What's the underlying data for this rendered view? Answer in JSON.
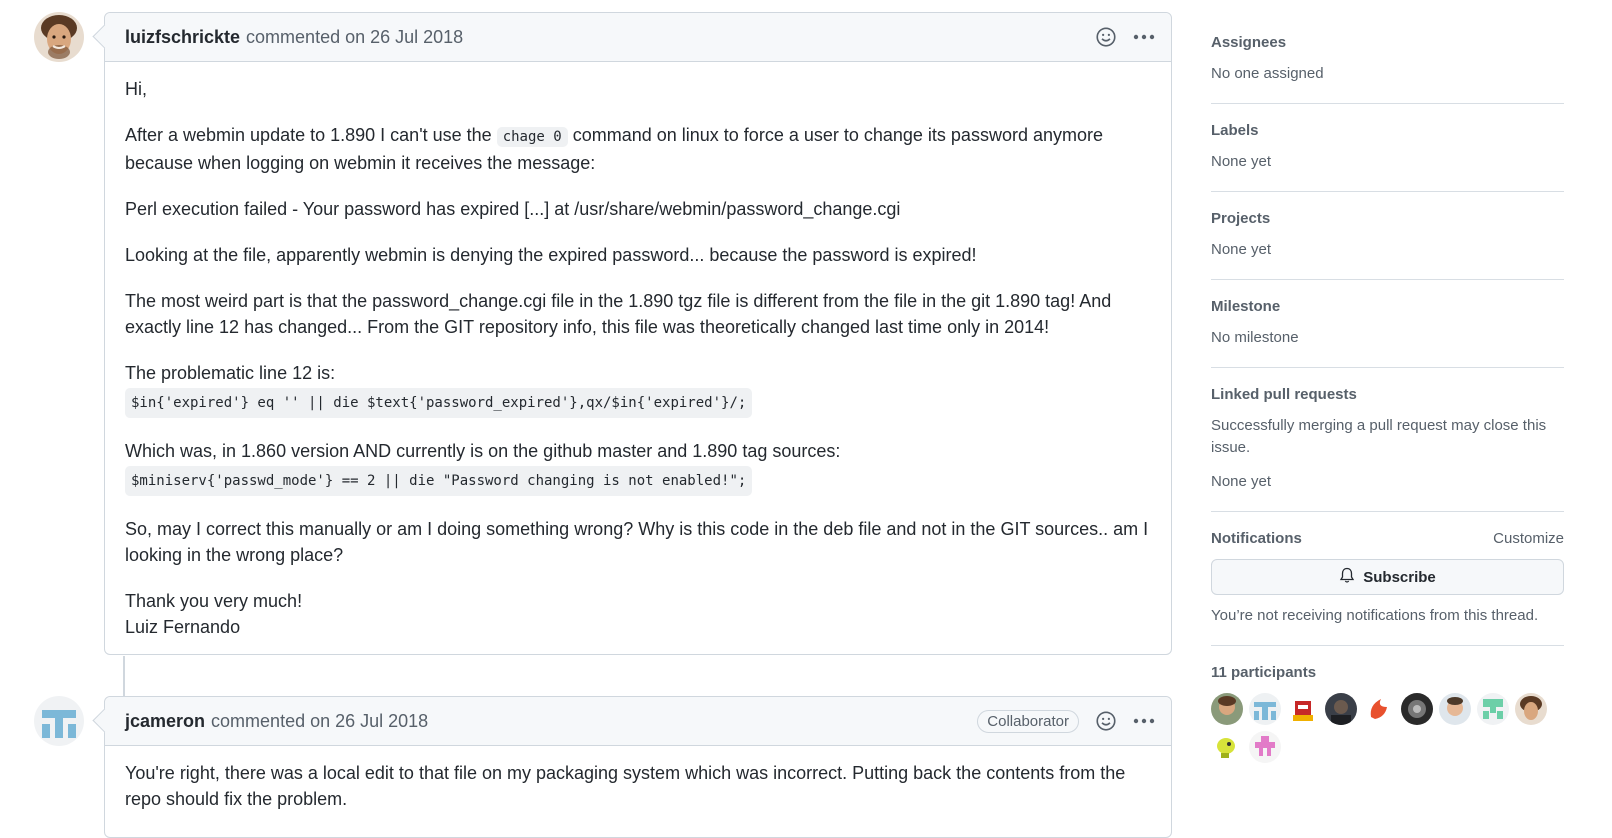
{
  "comments": [
    {
      "author": "luizfschrickte",
      "meta": "commented on 26 Jul 2018",
      "body": {
        "greeting": "Hi,",
        "p1_before": "After a webmin update to 1.890 I can't use the",
        "p1_code": "chage 0",
        "p1_after": "command on linux to force a user to change its password anymore because when logging on webmin it receives the message:",
        "p2": "Perl execution failed - Your password has expired [...] at /usr/share/webmin/password_change.cgi",
        "p3": "Looking at the file, apparently webmin is denying the expired password... because the password is expired!",
        "p4": "The most weird part is that the password_change.cgi file in the 1.890 tgz file is different from the file in the git 1.890 tag! And exactly line 12 has changed... From the GIT repository info, this file was theoretically changed last time only in 2014!",
        "p5_text": "The problematic line 12 is:",
        "p5_code": "$in{'expired'} eq '' || die $text{'password_expired'},qx/$in{'expired'}/;",
        "p6_text": "Which was, in 1.860 version AND currently is on the github master and 1.890 tag sources:",
        "p6_code": "$miniserv{'passwd_mode'} == 2 || die \"Password changing is not enabled!\";",
        "p7": "So, may I correct this manually or am I doing something wrong? Why is this code in the deb file and not in the GIT sources.. am I looking in the wrong place?",
        "p8_line1": "Thank you very much!",
        "p8_line2": "Luiz Fernando"
      }
    },
    {
      "author": "jcameron",
      "meta": "commented on 26 Jul 2018",
      "badge": "Collaborator",
      "body": {
        "p1": "You're right, there was a local edit to that file on my packaging system which was incorrect. Putting back the contents from the repo should fix the problem."
      }
    }
  ],
  "sidebar": {
    "assignees": {
      "title": "Assignees",
      "value": "No one assigned"
    },
    "labels": {
      "title": "Labels",
      "value": "None yet"
    },
    "projects": {
      "title": "Projects",
      "value": "None yet"
    },
    "milestone": {
      "title": "Milestone",
      "value": "No milestone"
    },
    "linked": {
      "title": "Linked pull requests",
      "description": "Successfully merging a pull request may close this issue.",
      "value": "None yet"
    },
    "notifications": {
      "title": "Notifications",
      "customize": "Customize",
      "subscribe": "Subscribe",
      "status": "You’re not receiving notifications from this thread."
    },
    "participants": {
      "title": "11 participants"
    }
  },
  "icons": {
    "emoji": "smiley-icon",
    "more": "kebab-horizontal-icon",
    "bell": "bell-icon"
  }
}
